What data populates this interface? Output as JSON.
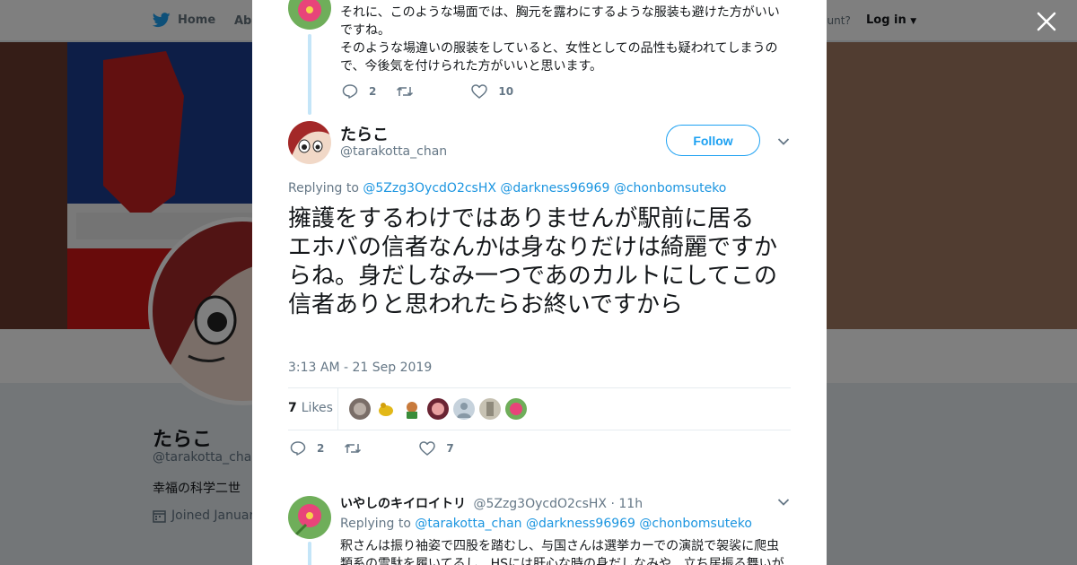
{
  "nav": {
    "home": "Home",
    "about": "Abo",
    "account_prompt": "ccount?",
    "login": "Log in"
  },
  "profile_bg": {
    "name": "たらこ",
    "handle": "@tarakotta_chan",
    "bio": "幸福の科学二世",
    "joined": "Joined Januar"
  },
  "previous_tweet": {
    "lines": [
      "それに、このような場面では、胸元を露わにするような服装も避けた方がいい",
      "ですね。",
      "そのような場違いの服装をしていると、女性としての品性も疑われてしまうの",
      "で、今後気を付けられた方がいいと思います。"
    ],
    "reply_count": "2",
    "like_count": "10"
  },
  "main_tweet": {
    "name": "たらこ",
    "handle": "@tarakotta_chan",
    "follow_label": "Follow",
    "replying_prefix": "Replying to",
    "mentions": [
      "@5Zzg3OycdO2csHX",
      "@darkness96969",
      "@chonbomsuteko"
    ],
    "text": "擁護をするわけではありませんが駅前に居るエホバの信者なんかは身なりだけは綺麗ですからね。身だしなみ一つであのカルトにしてこの信者ありと思われたらお終いですから",
    "timestamp": "3:13 AM - 21 Sep 2019",
    "likes_count": "7",
    "likes_label": "Likes",
    "reply_count": "2",
    "like_count": "7"
  },
  "reply_tweet": {
    "name": "いやしのキイロイトリ",
    "handle": "@5Zzg3OycdO2csHX",
    "time": "· 11h",
    "replying_prefix": "Replying to",
    "mentions": [
      "@tarakotta_chan",
      "@darkness96969",
      "@chonbomsuteko"
    ],
    "lines": [
      "釈さんは振り袖姿で四股を踏むし、与国さんは選挙カーでの演説で袈裟に爬虫",
      "類系の雪駄を履いてるし、HSには肝心な時の身だしなみや、立ち居振る舞いが"
    ]
  },
  "colors": {
    "accent": "#1da1f2",
    "link": "#1b95e0",
    "thread_line": "#c4e5f8"
  }
}
